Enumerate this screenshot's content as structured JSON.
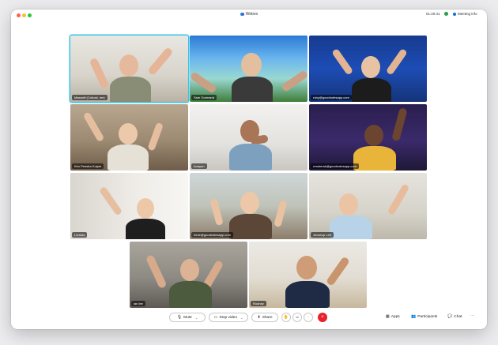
{
  "window": {
    "title": "Webex",
    "timer": "01:20:41",
    "meeting_info_label": "Meeting info"
  },
  "participants": [
    {
      "name": "Maxwell (Cohost, me)",
      "active": true
    },
    {
      "name": "Sam Gormand"
    },
    {
      "name": "ruby@goodnotesapp.com"
    },
    {
      "name": "Kim Peestra Kuiper"
    },
    {
      "name": "Anayan"
    },
    {
      "name": "rmuberak@goodnotesapp.com"
    },
    {
      "name": "Lorrass"
    },
    {
      "name": "irene@goodnotesapp.com"
    },
    {
      "name": "Jeoseop Lett"
    },
    {
      "name": "ian lee"
    },
    {
      "name": "Rodney"
    }
  ],
  "controls": {
    "mute": "Mute",
    "stop_video": "Stop video",
    "share": "Share",
    "apps": "Apps",
    "participants": "Participants",
    "chat": "Chat",
    "more": "···"
  },
  "colors": {
    "active_border": "#37c4e6",
    "end_call": "#e7222d"
  }
}
